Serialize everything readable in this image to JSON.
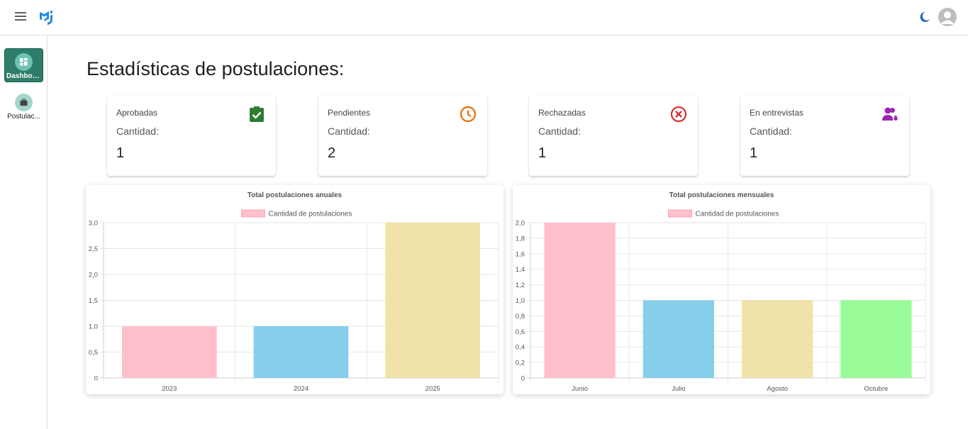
{
  "header": {
    "menu_icon": "menu-icon",
    "logo_icon": "mui-logo-icon",
    "theme_icon": "moon-icon",
    "account_icon": "account-icon"
  },
  "sidebar": {
    "items": [
      {
        "label": "Dashboo...",
        "icon": "dashboard-icon",
        "active": true
      },
      {
        "label": "Postulac...",
        "icon": "briefcase-icon",
        "active": false
      }
    ]
  },
  "page": {
    "title": "Estadísticas de postulaciones:"
  },
  "cards": [
    {
      "title": "Aprobadas",
      "sub": "Cantidad:",
      "value": "1",
      "icon": "clipboard-check-icon",
      "color": "#2e7d32"
    },
    {
      "title": "Pendientes",
      "sub": "Cantidad:",
      "value": "2",
      "icon": "clock-icon",
      "color": "#ef6c00"
    },
    {
      "title": "Rechazadas",
      "sub": "Cantidad:",
      "value": "1",
      "icon": "cancel-circle-icon",
      "color": "#d32f2f"
    },
    {
      "title": "En entrevistas",
      "sub": "Cantidad:",
      "value": "1",
      "icon": "record-voice-icon",
      "color": "#9c27b0"
    }
  ],
  "chart_data": [
    {
      "type": "bar",
      "title": "Total postulaciones anuales",
      "legend": "Cantidad de postulaciones",
      "categories": [
        "2023",
        "2024",
        "2025"
      ],
      "values": [
        1,
        1,
        3
      ],
      "colors": [
        "#ffc0cb",
        "#87ceeb",
        "#f0e2a8"
      ],
      "ylim": [
        0,
        3
      ],
      "yticks": [
        "3,0",
        "2,5",
        "2,0",
        "1,5",
        "1,0",
        "0,5",
        "0"
      ],
      "ytick_values": [
        3,
        2.5,
        2,
        1.5,
        1,
        0.5,
        0
      ],
      "grid": true
    },
    {
      "type": "bar",
      "title": "Total postulaciones mensuales",
      "legend": "Cantidad de postulaciones",
      "categories": [
        "Junio",
        "Julio",
        "Agosto",
        "Octubre"
      ],
      "values": [
        2,
        1,
        1,
        1
      ],
      "colors": [
        "#ffc0cb",
        "#87ceeb",
        "#f0e2a8",
        "#98fb98"
      ],
      "ylim": [
        0,
        2
      ],
      "yticks": [
        "2,0",
        "1,8",
        "1,6",
        "1,4",
        "1,2",
        "1,0",
        "0,8",
        "0,6",
        "0,4",
        "0,2",
        "0"
      ],
      "ytick_values": [
        2,
        1.8,
        1.6,
        1.4,
        1.2,
        1,
        0.8,
        0.6,
        0.4,
        0.2,
        0
      ],
      "grid": true
    }
  ]
}
